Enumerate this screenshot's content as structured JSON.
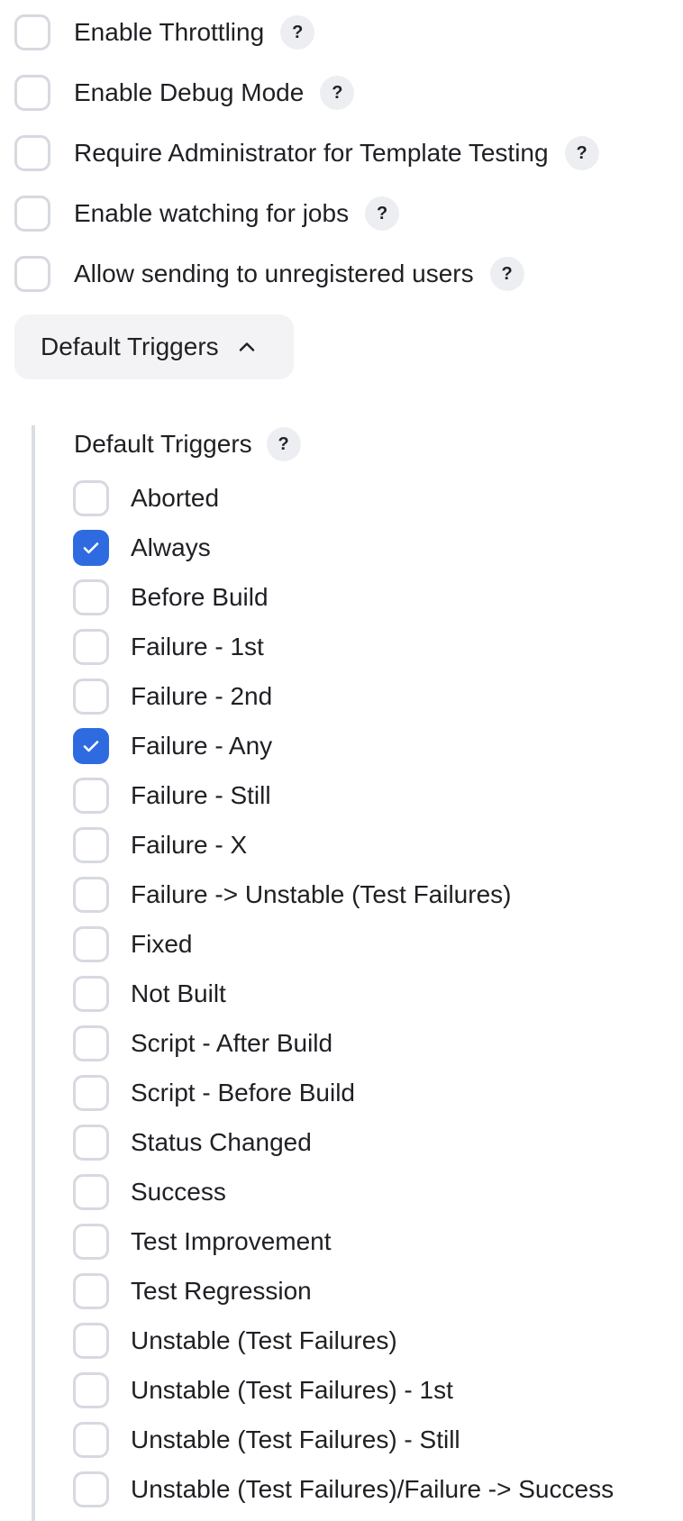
{
  "options": [
    {
      "label": "Enable Throttling",
      "checked": false
    },
    {
      "label": "Enable Debug Mode",
      "checked": false
    },
    {
      "label": "Require Administrator for Template Testing",
      "checked": false
    },
    {
      "label": "Enable watching for jobs",
      "checked": false
    },
    {
      "label": "Allow sending to unregistered users",
      "checked": false
    }
  ],
  "help_glyph": "?",
  "toggle": {
    "label": "Default Triggers",
    "expanded": true
  },
  "section": {
    "title": "Default Triggers",
    "triggers": [
      {
        "label": "Aborted",
        "checked": false
      },
      {
        "label": "Always",
        "checked": true
      },
      {
        "label": "Before Build",
        "checked": false
      },
      {
        "label": "Failure - 1st",
        "checked": false
      },
      {
        "label": "Failure - 2nd",
        "checked": false
      },
      {
        "label": "Failure - Any",
        "checked": true
      },
      {
        "label": "Failure - Still",
        "checked": false
      },
      {
        "label": "Failure - X",
        "checked": false
      },
      {
        "label": "Failure -> Unstable (Test Failures)",
        "checked": false
      },
      {
        "label": "Fixed",
        "checked": false
      },
      {
        "label": "Not Built",
        "checked": false
      },
      {
        "label": "Script - After Build",
        "checked": false
      },
      {
        "label": "Script - Before Build",
        "checked": false
      },
      {
        "label": "Status Changed",
        "checked": false
      },
      {
        "label": "Success",
        "checked": false
      },
      {
        "label": "Test Improvement",
        "checked": false
      },
      {
        "label": "Test Regression",
        "checked": false
      },
      {
        "label": "Unstable (Test Failures)",
        "checked": false
      },
      {
        "label": "Unstable (Test Failures) - 1st",
        "checked": false
      },
      {
        "label": "Unstable (Test Failures) - Still",
        "checked": false
      },
      {
        "label": "Unstable (Test Failures)/Failure -> Success",
        "checked": false
      }
    ]
  },
  "colors": {
    "accent": "#2f6be0",
    "checkbox_border": "#d6d9e0",
    "help_bg": "#eceef2",
    "toggle_bg": "#f3f3f6",
    "section_rule": "#d9dde4"
  },
  "icons": {
    "check": "check-icon",
    "help": "help-icon",
    "chevron": "chevron-up-icon"
  }
}
